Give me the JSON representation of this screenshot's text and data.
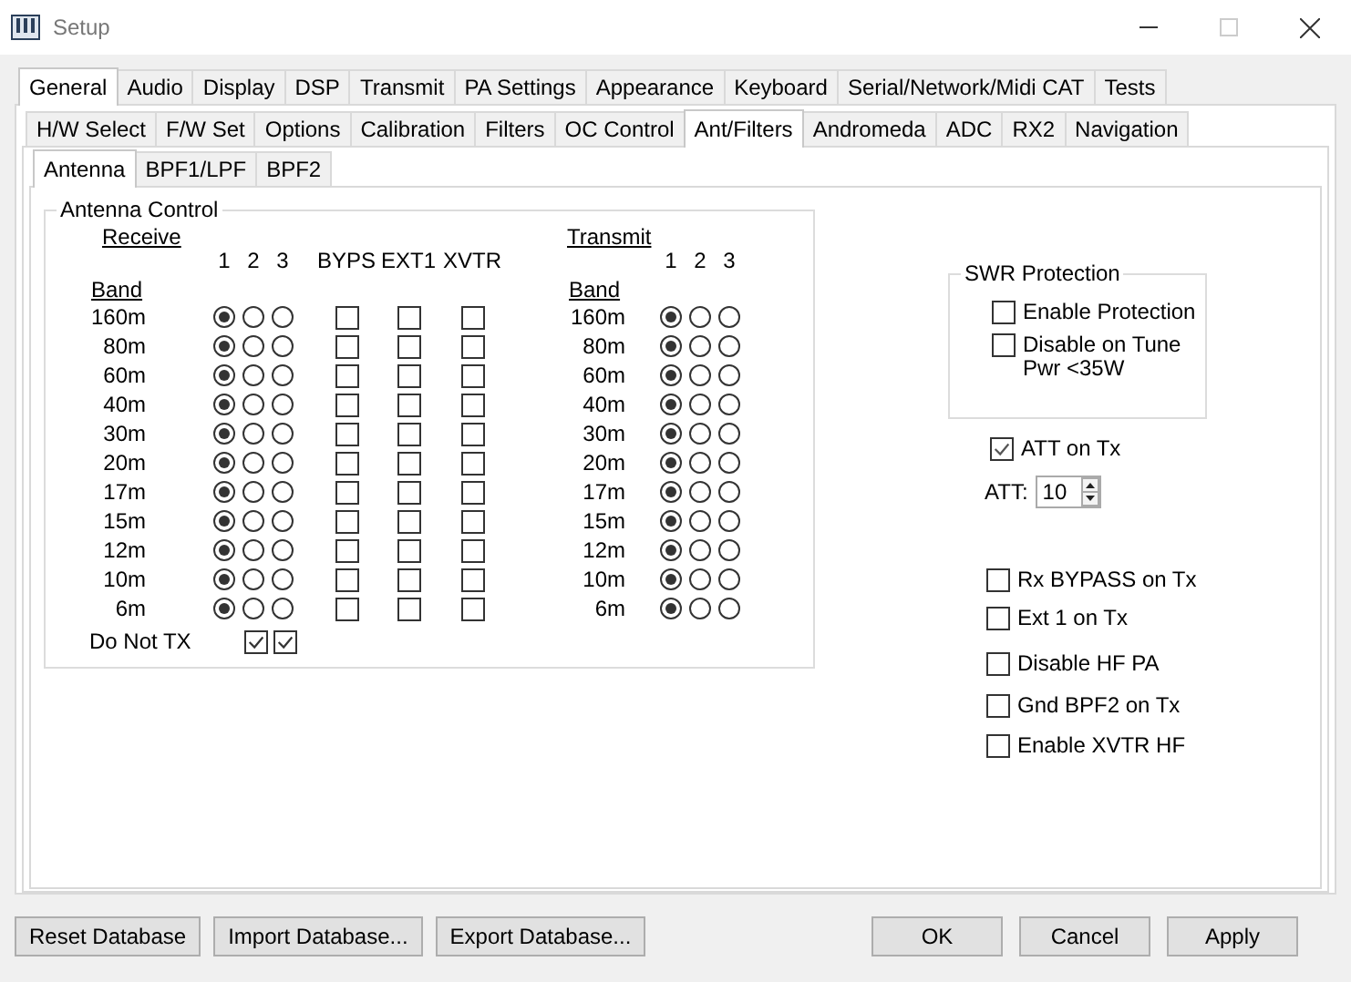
{
  "window": {
    "title": "Setup"
  },
  "main_tabs": [
    {
      "label": "General",
      "selected": true
    },
    {
      "label": "Audio",
      "selected": false
    },
    {
      "label": "Display",
      "selected": false
    },
    {
      "label": "DSP",
      "selected": false
    },
    {
      "label": "Transmit",
      "selected": false
    },
    {
      "label": "PA Settings",
      "selected": false
    },
    {
      "label": "Appearance",
      "selected": false
    },
    {
      "label": "Keyboard",
      "selected": false
    },
    {
      "label": "Serial/Network/Midi CAT",
      "selected": false
    },
    {
      "label": "Tests",
      "selected": false
    }
  ],
  "sub_tabs": [
    {
      "label": "H/W Select",
      "selected": false
    },
    {
      "label": "F/W Set",
      "selected": false
    },
    {
      "label": "Options",
      "selected": false
    },
    {
      "label": "Calibration",
      "selected": false
    },
    {
      "label": "Filters",
      "selected": false
    },
    {
      "label": "OC Control",
      "selected": false
    },
    {
      "label": "Ant/Filters",
      "selected": true
    },
    {
      "label": "Andromeda",
      "selected": false
    },
    {
      "label": "ADC",
      "selected": false
    },
    {
      "label": "RX2",
      "selected": false
    },
    {
      "label": "Navigation",
      "selected": false
    }
  ],
  "inner_tabs": [
    {
      "label": "Antenna",
      "selected": true
    },
    {
      "label": "BPF1/LPF",
      "selected": false
    },
    {
      "label": "BPF2",
      "selected": false
    }
  ],
  "antenna_control": {
    "title": "Antenna Control",
    "receive_header": "Receive",
    "transmit_header": "Transmit",
    "rx_band_header": "Band",
    "tx_band_header": "Band",
    "rx_columns": [
      "1",
      "2",
      "3"
    ],
    "check_columns": [
      "BYPS",
      "EXT1",
      "XVTR"
    ],
    "tx_columns": [
      "1",
      "2",
      "3"
    ],
    "rx_rows": [
      {
        "band": "160m",
        "radios": [
          {
            "selected": true
          },
          {
            "selected": false
          },
          {
            "selected": false
          }
        ],
        "checks": [
          {
            "checked": false
          },
          {
            "checked": false
          },
          {
            "checked": false
          }
        ]
      },
      {
        "band": "80m",
        "radios": [
          {
            "selected": true
          },
          {
            "selected": false
          },
          {
            "selected": false
          }
        ],
        "checks": [
          {
            "checked": false
          },
          {
            "checked": false
          },
          {
            "checked": false
          }
        ]
      },
      {
        "band": "60m",
        "radios": [
          {
            "selected": true
          },
          {
            "selected": false
          },
          {
            "selected": false
          }
        ],
        "checks": [
          {
            "checked": false
          },
          {
            "checked": false
          },
          {
            "checked": false
          }
        ]
      },
      {
        "band": "40m",
        "radios": [
          {
            "selected": true
          },
          {
            "selected": false
          },
          {
            "selected": false
          }
        ],
        "checks": [
          {
            "checked": false
          },
          {
            "checked": false
          },
          {
            "checked": false
          }
        ]
      },
      {
        "band": "30m",
        "radios": [
          {
            "selected": true
          },
          {
            "selected": false
          },
          {
            "selected": false
          }
        ],
        "checks": [
          {
            "checked": false
          },
          {
            "checked": false
          },
          {
            "checked": false
          }
        ]
      },
      {
        "band": "20m",
        "radios": [
          {
            "selected": true
          },
          {
            "selected": false
          },
          {
            "selected": false
          }
        ],
        "checks": [
          {
            "checked": false
          },
          {
            "checked": false
          },
          {
            "checked": false
          }
        ]
      },
      {
        "band": "17m",
        "radios": [
          {
            "selected": true
          },
          {
            "selected": false
          },
          {
            "selected": false
          }
        ],
        "checks": [
          {
            "checked": false
          },
          {
            "checked": false
          },
          {
            "checked": false
          }
        ]
      },
      {
        "band": "15m",
        "radios": [
          {
            "selected": true
          },
          {
            "selected": false
          },
          {
            "selected": false
          }
        ],
        "checks": [
          {
            "checked": false
          },
          {
            "checked": false
          },
          {
            "checked": false
          }
        ]
      },
      {
        "band": "12m",
        "radios": [
          {
            "selected": true
          },
          {
            "selected": false
          },
          {
            "selected": false
          }
        ],
        "checks": [
          {
            "checked": false
          },
          {
            "checked": false
          },
          {
            "checked": false
          }
        ]
      },
      {
        "band": "10m",
        "radios": [
          {
            "selected": true
          },
          {
            "selected": false
          },
          {
            "selected": false
          }
        ],
        "checks": [
          {
            "checked": false
          },
          {
            "checked": false
          },
          {
            "checked": false
          }
        ]
      },
      {
        "band": "6m",
        "radios": [
          {
            "selected": true
          },
          {
            "selected": false
          },
          {
            "selected": false
          }
        ],
        "checks": [
          {
            "checked": false
          },
          {
            "checked": false
          },
          {
            "checked": false
          }
        ]
      }
    ],
    "tx_rows": [
      {
        "band": "160m",
        "radios": [
          {
            "selected": true
          },
          {
            "selected": false
          },
          {
            "selected": false
          }
        ]
      },
      {
        "band": "80m",
        "radios": [
          {
            "selected": true
          },
          {
            "selected": false
          },
          {
            "selected": false
          }
        ]
      },
      {
        "band": "60m",
        "radios": [
          {
            "selected": true
          },
          {
            "selected": false
          },
          {
            "selected": false
          }
        ]
      },
      {
        "band": "40m",
        "radios": [
          {
            "selected": true
          },
          {
            "selected": false
          },
          {
            "selected": false
          }
        ]
      },
      {
        "band": "30m",
        "radios": [
          {
            "selected": true
          },
          {
            "selected": false
          },
          {
            "selected": false
          }
        ]
      },
      {
        "band": "20m",
        "radios": [
          {
            "selected": true
          },
          {
            "selected": false
          },
          {
            "selected": false
          }
        ]
      },
      {
        "band": "17m",
        "radios": [
          {
            "selected": true
          },
          {
            "selected": false
          },
          {
            "selected": false
          }
        ]
      },
      {
        "band": "15m",
        "radios": [
          {
            "selected": true
          },
          {
            "selected": false
          },
          {
            "selected": false
          }
        ]
      },
      {
        "band": "12m",
        "radios": [
          {
            "selected": true
          },
          {
            "selected": false
          },
          {
            "selected": false
          }
        ]
      },
      {
        "band": "10m",
        "radios": [
          {
            "selected": true
          },
          {
            "selected": false
          },
          {
            "selected": false
          }
        ]
      },
      {
        "band": "6m",
        "radios": [
          {
            "selected": true
          },
          {
            "selected": false
          },
          {
            "selected": false
          }
        ]
      }
    ],
    "do_not_tx": {
      "label": "Do Not TX",
      "checks": [
        {
          "checked": true
        },
        {
          "checked": true
        }
      ]
    }
  },
  "swr_protection": {
    "title": "SWR Protection",
    "options": [
      {
        "label": "Enable Protection",
        "checked": false
      },
      {
        "label": "Disable on Tune Pwr <35W",
        "checked": false
      }
    ]
  },
  "att_on_tx": {
    "label": "ATT on Tx",
    "checked": true
  },
  "att": {
    "label": "ATT:",
    "value": "10"
  },
  "options": [
    {
      "label": "Rx BYPASS on Tx",
      "checked": false
    },
    {
      "label": "Ext 1 on Tx",
      "checked": false
    },
    {
      "label": "Disable HF PA",
      "checked": false
    },
    {
      "label": "Gnd BPF2 on Tx",
      "checked": false
    },
    {
      "label": "Enable XVTR HF",
      "checked": false
    }
  ],
  "left_buttons": [
    "Reset Database",
    "Import Database...",
    "Export Database..."
  ],
  "right_buttons": [
    "OK",
    "Cancel",
    "Apply"
  ]
}
